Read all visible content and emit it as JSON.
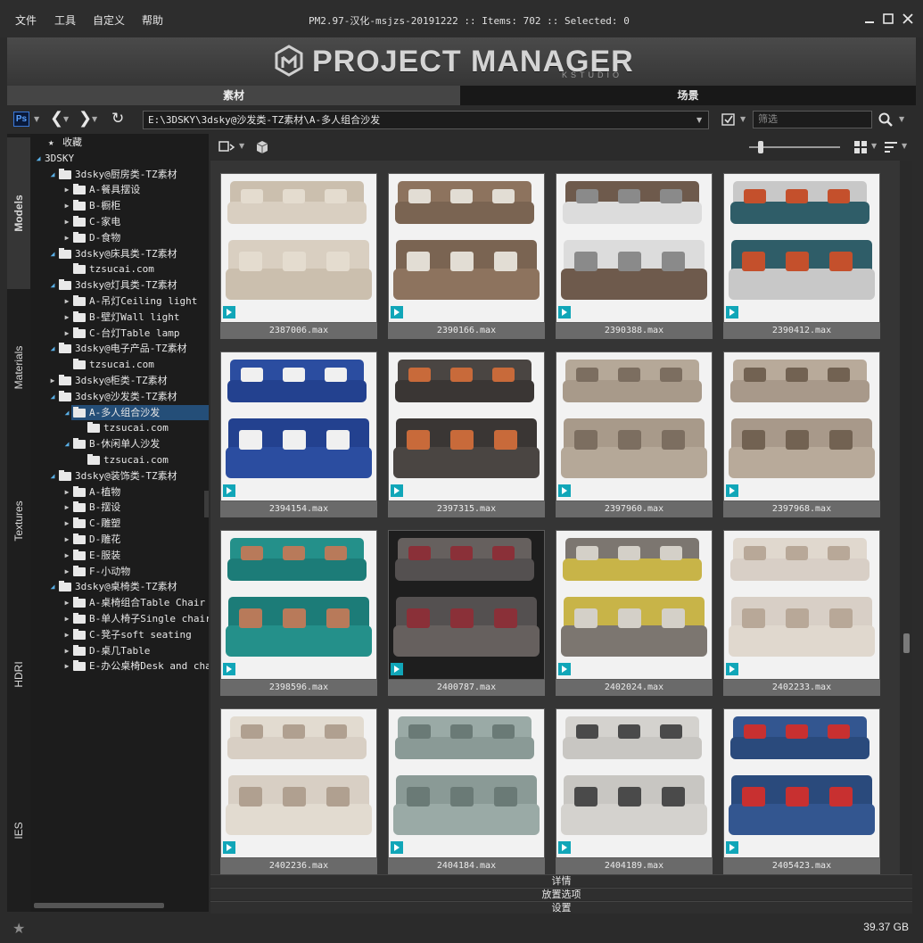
{
  "menu": {
    "items": [
      "文件",
      "工具",
      "自定义",
      "帮助"
    ]
  },
  "title_bar": {
    "app_version": "PM2.97-汉化-msjzs-20191222",
    "items_label": "Items:",
    "items_count": "702",
    "selected_label": "Selected:",
    "selected_count": "0"
  },
  "banner": {
    "title": "PROJECT MANAGER",
    "subtitle": "KSTUDIO"
  },
  "main_tabs": [
    {
      "label": "素材",
      "active": true
    },
    {
      "label": "场景",
      "active": false
    }
  ],
  "path_bar": {
    "path": "E:\\3DSKY\\3dsky@沙发类-TZ素材\\A-多人组合沙发",
    "filter_placeholder": "筛选"
  },
  "side_tabs": [
    "Models",
    "Materials",
    "Textures",
    "HDRI",
    "IES"
  ],
  "tree": [
    {
      "label": "收藏",
      "level": 0,
      "arrow": "none",
      "icon": "star"
    },
    {
      "label": "3DSKY",
      "level": 0,
      "arrow": "open",
      "icon": "none"
    },
    {
      "label": "3dsky@厨房类-TZ素材",
      "level": 1,
      "arrow": "open",
      "icon": "folder"
    },
    {
      "label": "A-餐具摆设",
      "level": 2,
      "arrow": "closed",
      "icon": "folder"
    },
    {
      "label": "B-橱柜",
      "level": 2,
      "arrow": "closed",
      "icon": "folder"
    },
    {
      "label": "C-家电",
      "level": 2,
      "arrow": "closed",
      "icon": "folder"
    },
    {
      "label": "D-食物",
      "level": 2,
      "arrow": "closed",
      "icon": "folder"
    },
    {
      "label": "3dsky@床具类-TZ素材",
      "level": 1,
      "arrow": "open",
      "icon": "folder"
    },
    {
      "label": "tzsucai.com",
      "level": 2,
      "arrow": "none",
      "icon": "folder"
    },
    {
      "label": "3dsky@灯具类-TZ素材",
      "level": 1,
      "arrow": "open",
      "icon": "folder"
    },
    {
      "label": "A-吊灯Ceiling light",
      "level": 2,
      "arrow": "closed",
      "icon": "folder"
    },
    {
      "label": "B-壁灯Wall light",
      "level": 2,
      "arrow": "closed",
      "icon": "folder"
    },
    {
      "label": "C-台灯Table lamp",
      "level": 2,
      "arrow": "closed",
      "icon": "folder"
    },
    {
      "label": "3dsky@电子产品-TZ素材",
      "level": 1,
      "arrow": "open",
      "icon": "folder"
    },
    {
      "label": "tzsucai.com",
      "level": 2,
      "arrow": "none",
      "icon": "folder"
    },
    {
      "label": "3dsky@柜类-TZ素材",
      "level": 1,
      "arrow": "closed",
      "icon": "folder"
    },
    {
      "label": "3dsky@沙发类-TZ素材",
      "level": 1,
      "arrow": "open",
      "icon": "folder"
    },
    {
      "label": "A-多人组合沙发",
      "level": 2,
      "arrow": "open",
      "icon": "folder",
      "selected": true
    },
    {
      "label": "tzsucai.com",
      "level": 3,
      "arrow": "none",
      "icon": "folder"
    },
    {
      "label": "B-休闲单人沙发",
      "level": 2,
      "arrow": "open",
      "icon": "folder"
    },
    {
      "label": "tzsucai.com",
      "level": 3,
      "arrow": "none",
      "icon": "folder"
    },
    {
      "label": "3dsky@装饰类-TZ素材",
      "level": 1,
      "arrow": "open",
      "icon": "folder"
    },
    {
      "label": "A-植物",
      "level": 2,
      "arrow": "closed",
      "icon": "folder"
    },
    {
      "label": "B-摆设",
      "level": 2,
      "arrow": "closed",
      "icon": "folder"
    },
    {
      "label": "C-雕塑",
      "level": 2,
      "arrow": "closed",
      "icon": "folder"
    },
    {
      "label": "D-雕花",
      "level": 2,
      "arrow": "closed",
      "icon": "folder"
    },
    {
      "label": "E-服装",
      "level": 2,
      "arrow": "closed",
      "icon": "folder"
    },
    {
      "label": "F-小动物",
      "level": 2,
      "arrow": "closed",
      "icon": "folder"
    },
    {
      "label": "3dsky@桌椅类-TZ素材",
      "level": 1,
      "arrow": "open",
      "icon": "folder"
    },
    {
      "label": "A-桌椅组合Table Chair",
      "level": 2,
      "arrow": "closed",
      "icon": "folder"
    },
    {
      "label": "B-单人椅子Single chair",
      "level": 2,
      "arrow": "closed",
      "icon": "folder"
    },
    {
      "label": "C-凳子soft seating",
      "level": 2,
      "arrow": "closed",
      "icon": "folder"
    },
    {
      "label": "D-桌几Table",
      "level": 2,
      "arrow": "closed",
      "icon": "folder"
    },
    {
      "label": "E-办公桌椅Desk and chair",
      "level": 2,
      "arrow": "closed",
      "icon": "folder"
    }
  ],
  "items": [
    {
      "name": "2387006.max",
      "colors": [
        "#d9cfc1",
        "#cbbfae",
        "#e4dccf"
      ]
    },
    {
      "name": "2390166.max",
      "colors": [
        "#7a6452",
        "#8d735e",
        "#e2ddd4"
      ]
    },
    {
      "name": "2390388.max",
      "colors": [
        "#dcdcdc",
        "#6e5a4c",
        "#8a8a8a"
      ]
    },
    {
      "name": "2390412.max",
      "colors": [
        "#2f5d68",
        "#c8c8c8",
        "#c4502c"
      ]
    },
    {
      "name": "2394154.max",
      "colors": [
        "#23418f",
        "#2b4da0",
        "#f0f0f0"
      ]
    },
    {
      "name": "2397315.max",
      "colors": [
        "#3a3634",
        "#4a4542",
        "#c86a3a"
      ]
    },
    {
      "name": "2397960.max",
      "colors": [
        "#a89a8a",
        "#b5a898",
        "#7c6e60"
      ]
    },
    {
      "name": "2397968.max",
      "colors": [
        "#a8998a",
        "#b8aa9a",
        "#726252"
      ]
    },
    {
      "name": "2398596.max",
      "colors": [
        "#1c7c78",
        "#24908a",
        "#b87a5a"
      ]
    },
    {
      "name": "2400787.max",
      "colors": [
        "#545050",
        "#66605e",
        "#8a3038"
      ]
    },
    {
      "name": "2402024.max",
      "colors": [
        "#c8b448",
        "#7c7670",
        "#d4d0c8"
      ]
    },
    {
      "name": "2402233.max",
      "colors": [
        "#d8cfc6",
        "#e0d8ce",
        "#b8a898"
      ]
    },
    {
      "name": "2402236.max",
      "colors": [
        "#d8cfc4",
        "#e2dbd0",
        "#b0a090"
      ]
    },
    {
      "name": "2404184.max",
      "colors": [
        "#8a9a96",
        "#9aaaa6",
        "#6a7a76"
      ]
    },
    {
      "name": "2404189.max",
      "colors": [
        "#c8c6c2",
        "#d4d2ce",
        "#4a4a4a"
      ]
    },
    {
      "name": "2405423.max",
      "colors": [
        "#2a4a7c",
        "#335690",
        "#c83030"
      ]
    }
  ],
  "bottom_panels": [
    "详情",
    "放置选项",
    "设置"
  ],
  "status": {
    "disk_free": "39.37 GB"
  },
  "colors": {
    "accent_selected": "#244e78",
    "max_badge": "#11a6b8",
    "tree_open_arrow": "#5ab0e8"
  }
}
